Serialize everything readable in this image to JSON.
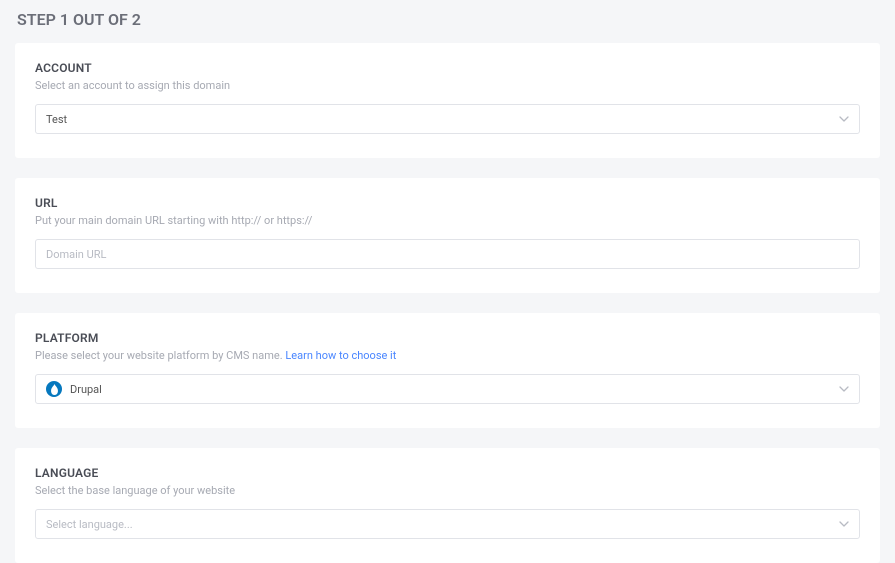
{
  "page_title": "STEP 1 OUT OF 2",
  "account": {
    "title": "ACCOUNT",
    "subtitle": "Select an account to assign this domain",
    "selected": "Test"
  },
  "url": {
    "title": "URL",
    "subtitle": "Put your main domain URL starting with http:// or https://",
    "placeholder": "Domain URL",
    "value": ""
  },
  "platform": {
    "title": "PLATFORM",
    "subtitle_prefix": "Please select your website platform by CMS name. ",
    "link_text": "Learn how to choose it",
    "selected": "Drupal"
  },
  "language": {
    "title": "LANGUAGE",
    "subtitle": "Select the base language of your website",
    "placeholder": "Select language..."
  }
}
